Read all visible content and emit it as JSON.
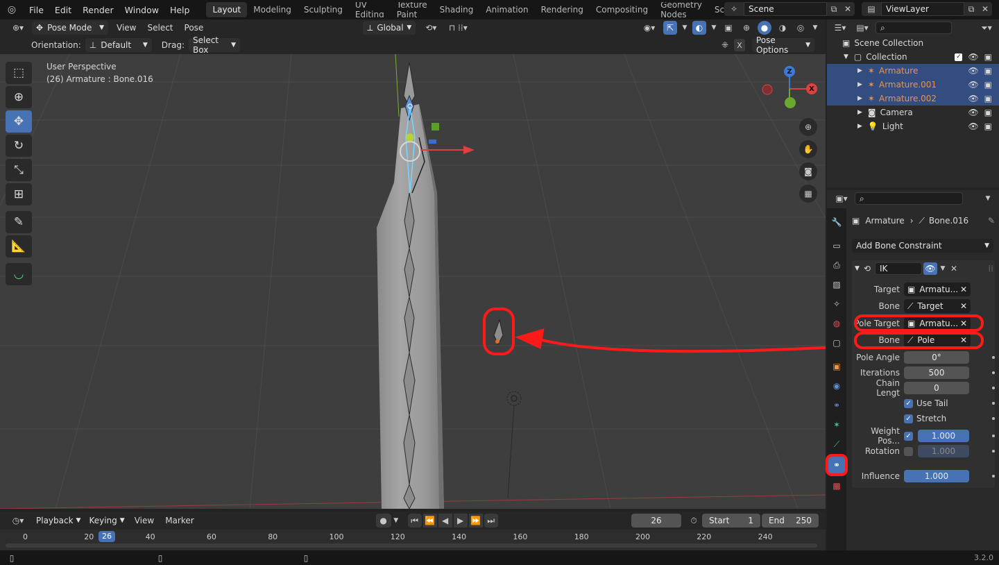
{
  "menu": {
    "items": [
      "File",
      "Edit",
      "Render",
      "Window",
      "Help"
    ],
    "workspaces": [
      "Layout",
      "Modeling",
      "Sculpting",
      "UV Editing",
      "Texture Paint",
      "Shading",
      "Animation",
      "Rendering",
      "Compositing",
      "Geometry Nodes",
      "Scripting"
    ],
    "scene": "Scene",
    "view_layer": "ViewLayer"
  },
  "header": {
    "mode": "Pose Mode",
    "menus": [
      "View",
      "Select",
      "Pose"
    ],
    "transform_orientation": "Global",
    "orientation_label": "Orientation:",
    "orientation_value": "Default",
    "drag_label": "Drag:",
    "drag_value": "Select Box",
    "pose_options": "Pose Options",
    "x_label": "X"
  },
  "viewport": {
    "perspective": "User Perspective",
    "selection": "(26) Armature : Bone.016",
    "gizmo": {
      "z": "Z",
      "x": "X"
    }
  },
  "timeline": {
    "menus": [
      "Playback",
      "Keying",
      "View",
      "Marker"
    ],
    "current_frame": "26",
    "start_label": "Start",
    "start": "1",
    "end_label": "End",
    "end": "250",
    "ticks": [
      "0",
      "20",
      "40",
      "60",
      "80",
      "100",
      "120",
      "140",
      "160",
      "180",
      "200",
      "220",
      "240"
    ],
    "marker": "26"
  },
  "outliner": {
    "scene_collection": "Scene Collection",
    "collection": "Collection",
    "items": [
      {
        "name": "Armature",
        "selected": true,
        "color": "#e8964a"
      },
      {
        "name": "Armature.001",
        "selected": true,
        "color": "#e8964a"
      },
      {
        "name": "Armature.002",
        "selected": true,
        "color": "#e8964a"
      },
      {
        "name": "Camera",
        "selected": false,
        "color": "#d8d8d8"
      },
      {
        "name": "Light",
        "selected": false,
        "color": "#d8d8d8"
      }
    ]
  },
  "properties": {
    "breadcrumb_object": "Armature",
    "breadcrumb_bone": "Bone.016",
    "add_constraint": "Add Bone Constraint",
    "constraint_name": "IK",
    "target_label": "Target",
    "target_value": "Armatu...",
    "bone_label": "Bone",
    "bone_value": "Target",
    "pole_target_label": "Pole Target",
    "pole_target_value": "Armatu...",
    "pole_bone_label": "Bone",
    "pole_bone_value": "Pole",
    "pole_angle_label": "Pole Angle",
    "pole_angle": "0°",
    "iterations_label": "Iterations",
    "iterations": "500",
    "chain_label": "Chain Lengt",
    "chain": "0",
    "use_tail": "Use Tail",
    "stretch": "Stretch",
    "weight_label": "Weight Pos...",
    "weight": "1.000",
    "rotation_label": "Rotation",
    "rotation": "1.000",
    "influence_label": "Influence",
    "influence": "1.000"
  },
  "status": {
    "version": "3.2.0"
  },
  "colors": {
    "accent": "#4772b3",
    "annotation": "#ff0000",
    "selected_row": "#334d80"
  }
}
